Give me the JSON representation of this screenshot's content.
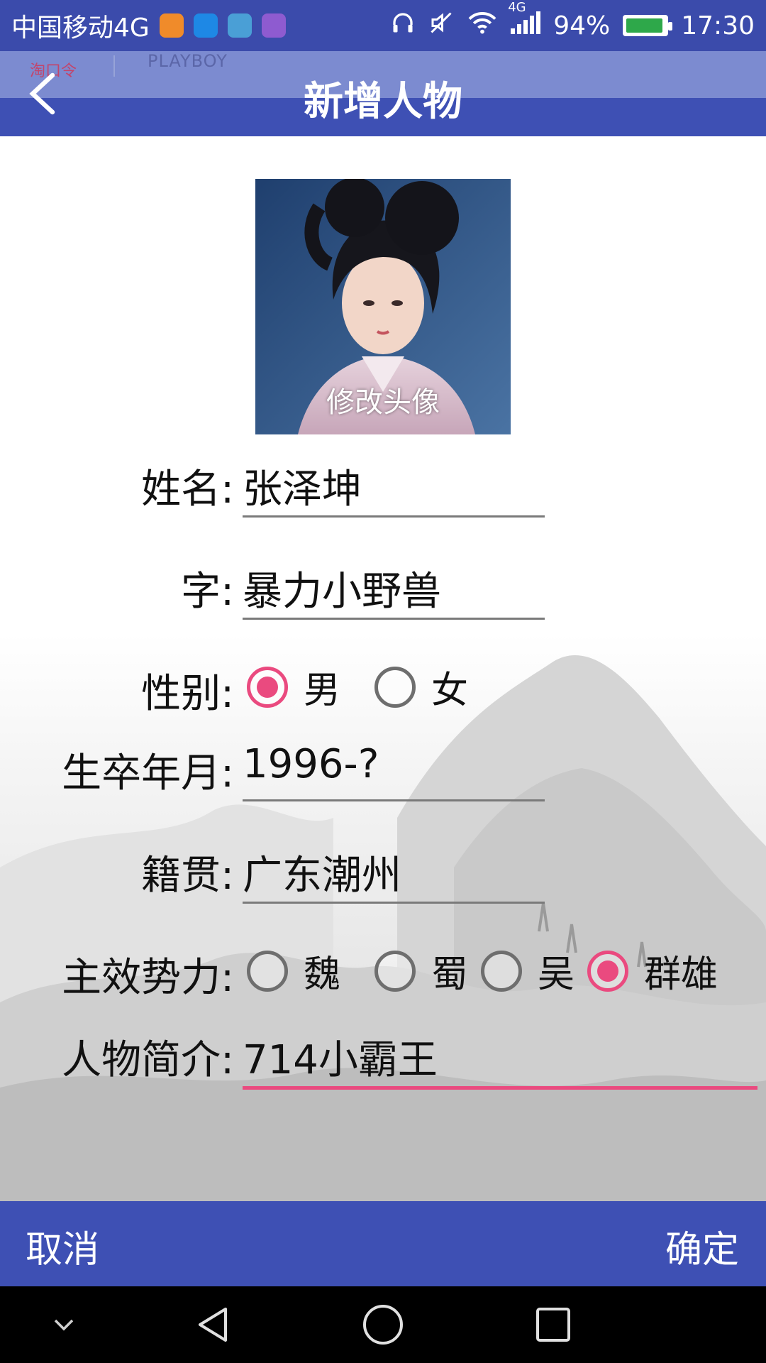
{
  "status_bar": {
    "carrier": "中国移动4G",
    "network_badge": "4G",
    "battery": "94%",
    "battery_level": 0.94,
    "time": "17:30",
    "icons": [
      "uc-browser-icon",
      "app-icon",
      "android-icon",
      "gallery-icon",
      "headphones-icon",
      "mute-icon",
      "wifi-icon",
      "signal-icon",
      "battery-icon"
    ]
  },
  "header": {
    "overlay_left": "淘口令",
    "overlay_right": "PLAYBOY",
    "title": "新增人物",
    "back_icon": "back-arrow-icon"
  },
  "avatar": {
    "label": "修改头像"
  },
  "form": {
    "name": {
      "label": "姓名:",
      "value": "张泽坤"
    },
    "courtesy": {
      "label": "字:",
      "value": "暴力小野兽"
    },
    "gender": {
      "label": "性别:",
      "options": [
        {
          "label": "男",
          "checked": true
        },
        {
          "label": "女",
          "checked": false
        }
      ]
    },
    "lifespan": {
      "label": "生卒年月:",
      "value": "1996-?"
    },
    "hometown": {
      "label": "籍贯:",
      "value": "广东潮州"
    },
    "faction": {
      "label": "主效势力:",
      "options": [
        {
          "label": "魏",
          "checked": false
        },
        {
          "label": "蜀",
          "checked": false
        },
        {
          "label": "吴",
          "checked": false
        },
        {
          "label": "群雄",
          "checked": true
        }
      ]
    },
    "intro": {
      "label": "人物简介:",
      "value": "714小霸王"
    }
  },
  "actions": {
    "cancel": "取消",
    "confirm": "确定"
  },
  "colors": {
    "primary": "#3e50b4",
    "accent": "#ea4a7f"
  }
}
